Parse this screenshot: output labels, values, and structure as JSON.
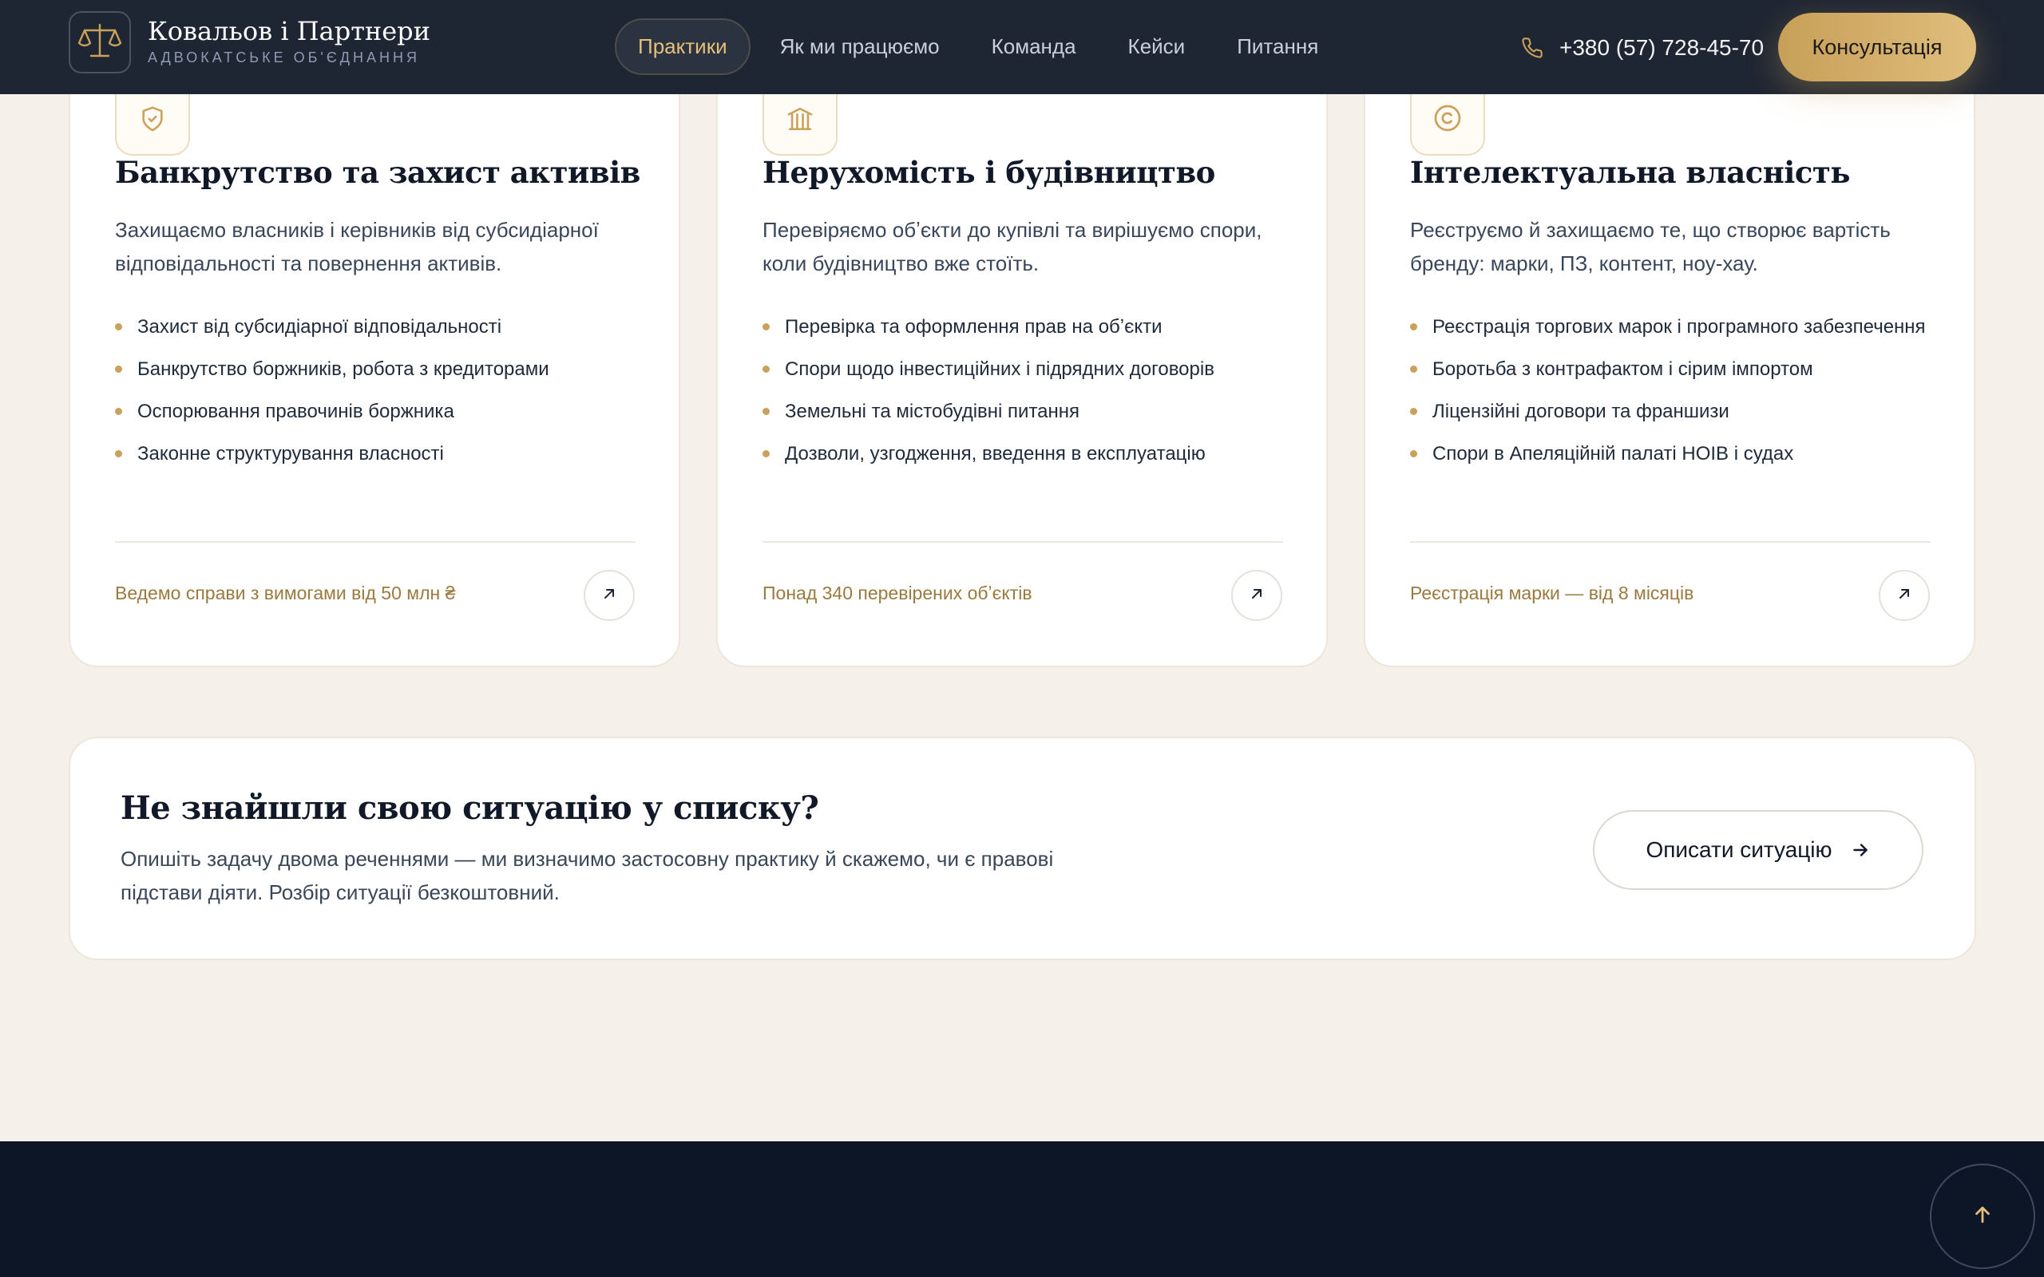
{
  "header": {
    "brand_title": "Ковальов і Партнери",
    "brand_subtitle": "АДВОКАТСЬКЕ ОБ'ЄДНАННЯ",
    "nav": [
      {
        "label": "Практики",
        "active": true
      },
      {
        "label": "Як ми працюємо",
        "active": false
      },
      {
        "label": "Команда",
        "active": false
      },
      {
        "label": "Кейси",
        "active": false
      },
      {
        "label": "Питання",
        "active": false
      }
    ],
    "phone": "+380 (57) 728-45-70",
    "consult_label": "Консультація"
  },
  "cards": [
    {
      "icon": "shield-icon",
      "title": "Банкрутство та захист активів",
      "description": "Захищаємо власників і керівників від субсидіарної відповідальності та повернення активів.",
      "items": [
        "Захист від субсидіарної відповідальності",
        "Банкрутство боржників, робота з кредиторами",
        "Оспорювання правочинів боржника",
        "Законне структурування власності"
      ],
      "footer": "Ведемо справи з вимогами від 50 млн ₴"
    },
    {
      "icon": "building-icon",
      "title": "Нерухомість і будівництво",
      "description": "Перевіряємо обʼєкти до купівлі та вирішуємо спори, коли будівництво вже стоїть.",
      "items": [
        "Перевірка та оформлення прав на обʼєкти",
        "Спори щодо інвестиційних і підрядних договорів",
        "Земельні та містобудівні питання",
        "Дозволи, узгодження, введення в експлуатацію"
      ],
      "footer": "Понад 340 перевірених обʼєктів"
    },
    {
      "icon": "copyright-icon",
      "title": "Інтелектуальна власність",
      "description": "Реєструємо й захищаємо те, що створює вартість бренду: марки, ПЗ, контент, ноу-хау.",
      "items": [
        "Реєстрація торгових марок і програмного забезпечення",
        "Боротьба з контрафактом і сірим імпортом",
        "Ліцензійні договори та франшизи",
        "Спори в Апеляційній палаті НОІВ і судах"
      ],
      "footer": "Реєстрація марки — від 8 місяців"
    }
  ],
  "cta": {
    "title": "Не знайшли свою ситуацію у списку?",
    "text": "Опишіть задачу двома реченнями — ми визначимо застосовну практику й скажемо, чи є правові підстави діяти. Розбір ситуації безкоштовний.",
    "button_label": "Описати ситуацію"
  },
  "colors": {
    "accent_gold": "#c9a15a",
    "header_bg": "#1f2633",
    "page_bg": "#f5f1ea",
    "footer_bg": "#0c1626"
  }
}
